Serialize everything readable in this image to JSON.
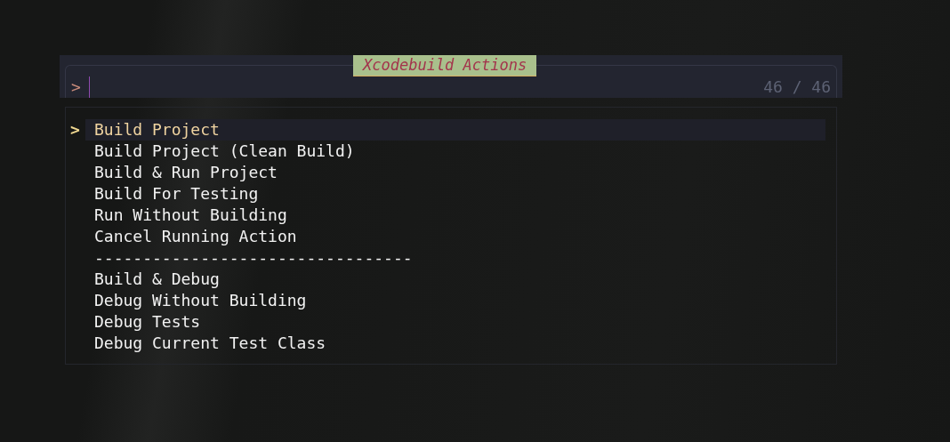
{
  "prompt": {
    "title": "Xcodebuild Actions",
    "prefix": ">",
    "counter": "46 / 46"
  },
  "results": {
    "marker": ">",
    "items": [
      {
        "label": "Build Project",
        "selected": true
      },
      {
        "label": "Build Project (Clean Build)",
        "selected": false
      },
      {
        "label": "Build & Run Project",
        "selected": false
      },
      {
        "label": "Build For Testing",
        "selected": false
      },
      {
        "label": "Run Without Building",
        "selected": false
      },
      {
        "label": "Cancel Running Action",
        "selected": false
      },
      {
        "label": "---------------------------------",
        "selected": false
      },
      {
        "label": "Build & Debug",
        "selected": false
      },
      {
        "label": "Debug Without Building",
        "selected": false
      },
      {
        "label": "Debug Tests",
        "selected": false
      },
      {
        "label": "Debug Current Test Class",
        "selected": false
      }
    ]
  }
}
